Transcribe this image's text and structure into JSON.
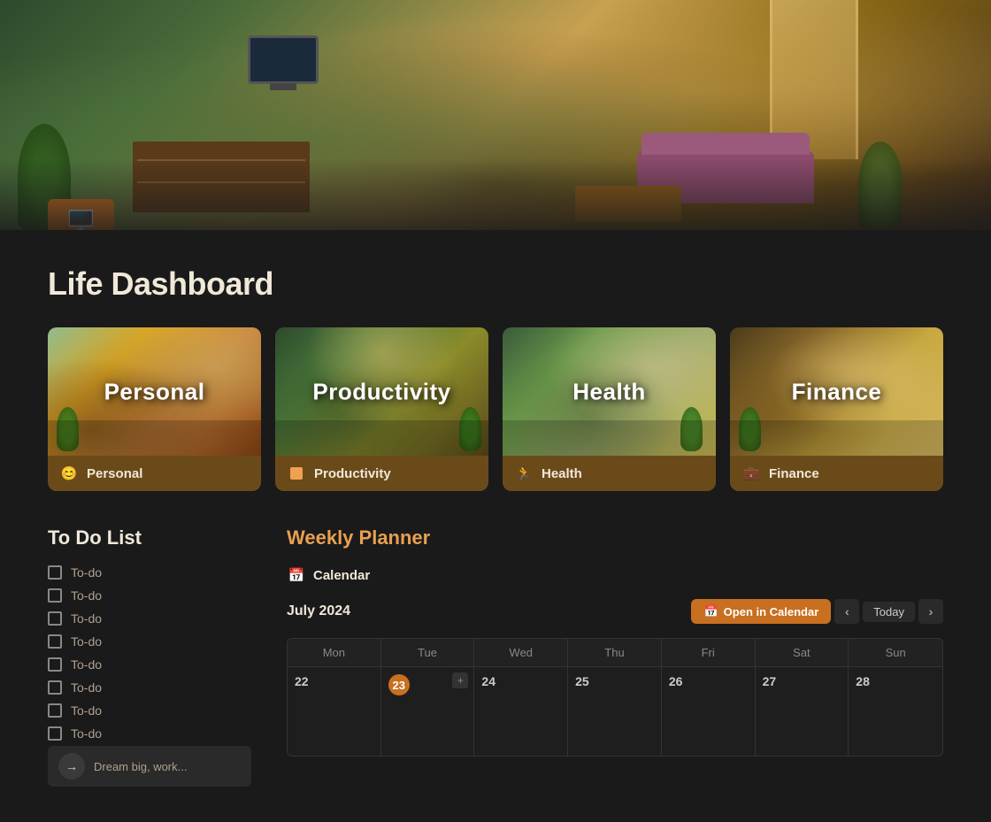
{
  "hero": {
    "icon_label": "📺"
  },
  "page": {
    "title": "Life Dashboard"
  },
  "categories": [
    {
      "id": "personal",
      "image_label": "Personal",
      "footer_icon": "😊",
      "footer_label": "Personal"
    },
    {
      "id": "productivity",
      "image_label": "Productivity",
      "footer_icon": "🟧",
      "footer_label": "Productivity"
    },
    {
      "id": "health",
      "image_label": "Health",
      "footer_icon": "🏃",
      "footer_label": "Health"
    },
    {
      "id": "finance",
      "image_label": "Finance",
      "footer_icon": "💼",
      "footer_label": "Finance"
    }
  ],
  "todo": {
    "title": "To Do List",
    "items": [
      {
        "text": "To-do"
      },
      {
        "text": "To-do"
      },
      {
        "text": "To-do"
      },
      {
        "text": "To-do"
      },
      {
        "text": "To-do"
      },
      {
        "text": "To-do"
      },
      {
        "text": "To-do"
      },
      {
        "text": "To-do"
      }
    ],
    "note_text": "Dream big, work..."
  },
  "planner": {
    "title": "Weekly Planner",
    "calendar_label": "Calendar",
    "month_label": "July 2024",
    "open_calendar_label": "Open in Calendar",
    "today_label": "Today",
    "days": [
      "Mon",
      "Tue",
      "Wed",
      "Thu",
      "Fri",
      "Sat",
      "Sun"
    ],
    "week_dates": [
      22,
      23,
      24,
      25,
      26,
      27,
      28
    ],
    "today_date": 23
  }
}
